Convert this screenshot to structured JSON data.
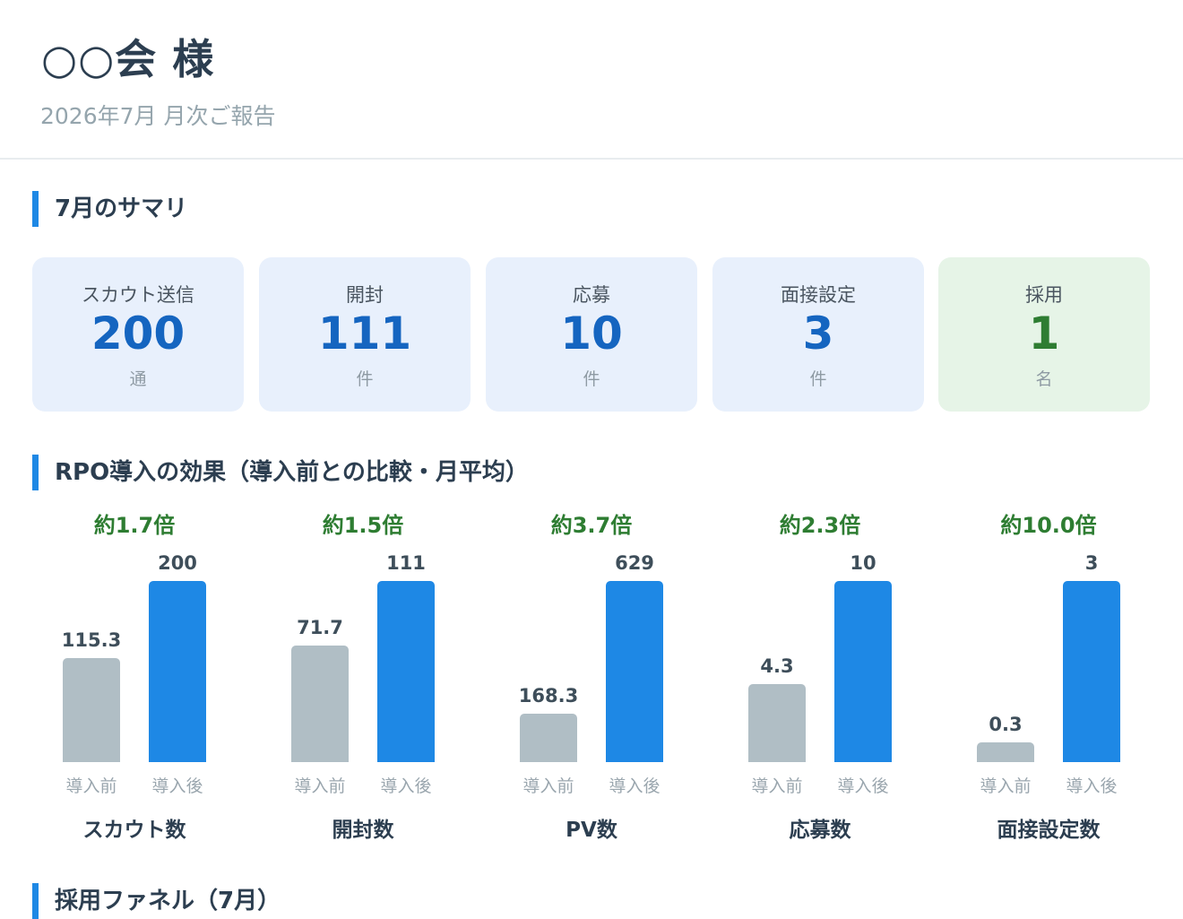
{
  "header": {
    "client_name": "○○会 様",
    "report_period": "2026年7月 月次ご報告"
  },
  "summary": {
    "title": "7月のサマリ",
    "cards": [
      {
        "label": "スカウト送信",
        "value": "200",
        "unit": "通"
      },
      {
        "label": "開封",
        "value": "111",
        "unit": "件"
      },
      {
        "label": "応募",
        "value": "10",
        "unit": "件"
      },
      {
        "label": "面接設定",
        "value": "3",
        "unit": "件"
      },
      {
        "label": "採用",
        "value": "1",
        "unit": "名"
      }
    ]
  },
  "effect": {
    "title": "RPO導入の効果（導入前との比較・月平均）"
  },
  "funnel": {
    "title": "採用ファネル（7月）"
  },
  "chart_data": [
    {
      "type": "bar",
      "ratio_label": "約1.7倍",
      "xlabel": "スカウト数",
      "categories": [
        "導入前",
        "導入後"
      ],
      "values": [
        115.3,
        200
      ],
      "value_labels": [
        "115.3",
        "200"
      ],
      "colors": [
        "#b0bec5",
        "#1e88e5"
      ]
    },
    {
      "type": "bar",
      "ratio_label": "約1.5倍",
      "xlabel": "開封数",
      "categories": [
        "導入前",
        "導入後"
      ],
      "values": [
        71.7,
        111
      ],
      "value_labels": [
        "71.7",
        "111"
      ],
      "colors": [
        "#b0bec5",
        "#1e88e5"
      ]
    },
    {
      "type": "bar",
      "ratio_label": "約3.7倍",
      "xlabel": "PV数",
      "categories": [
        "導入前",
        "導入後"
      ],
      "values": [
        168.3,
        629
      ],
      "value_labels": [
        "168.3",
        "629"
      ],
      "colors": [
        "#b0bec5",
        "#1e88e5"
      ]
    },
    {
      "type": "bar",
      "ratio_label": "約2.3倍",
      "xlabel": "応募数",
      "categories": [
        "導入前",
        "導入後"
      ],
      "values": [
        4.3,
        10
      ],
      "value_labels": [
        "4.3",
        "10"
      ],
      "colors": [
        "#b0bec5",
        "#1e88e5"
      ]
    },
    {
      "type": "bar",
      "ratio_label": "約10.0倍",
      "xlabel": "面接設定数",
      "categories": [
        "導入前",
        "導入後"
      ],
      "values": [
        0.3,
        3
      ],
      "value_labels": [
        "0.3",
        "3"
      ],
      "colors": [
        "#b0bec5",
        "#1e88e5"
      ]
    }
  ],
  "colors": {
    "accent": "#1e88e5",
    "positive": "#2e7d32",
    "card_blue": "#e8f0fc",
    "card_green": "#e6f4e7",
    "bar_before": "#b0bec5"
  }
}
